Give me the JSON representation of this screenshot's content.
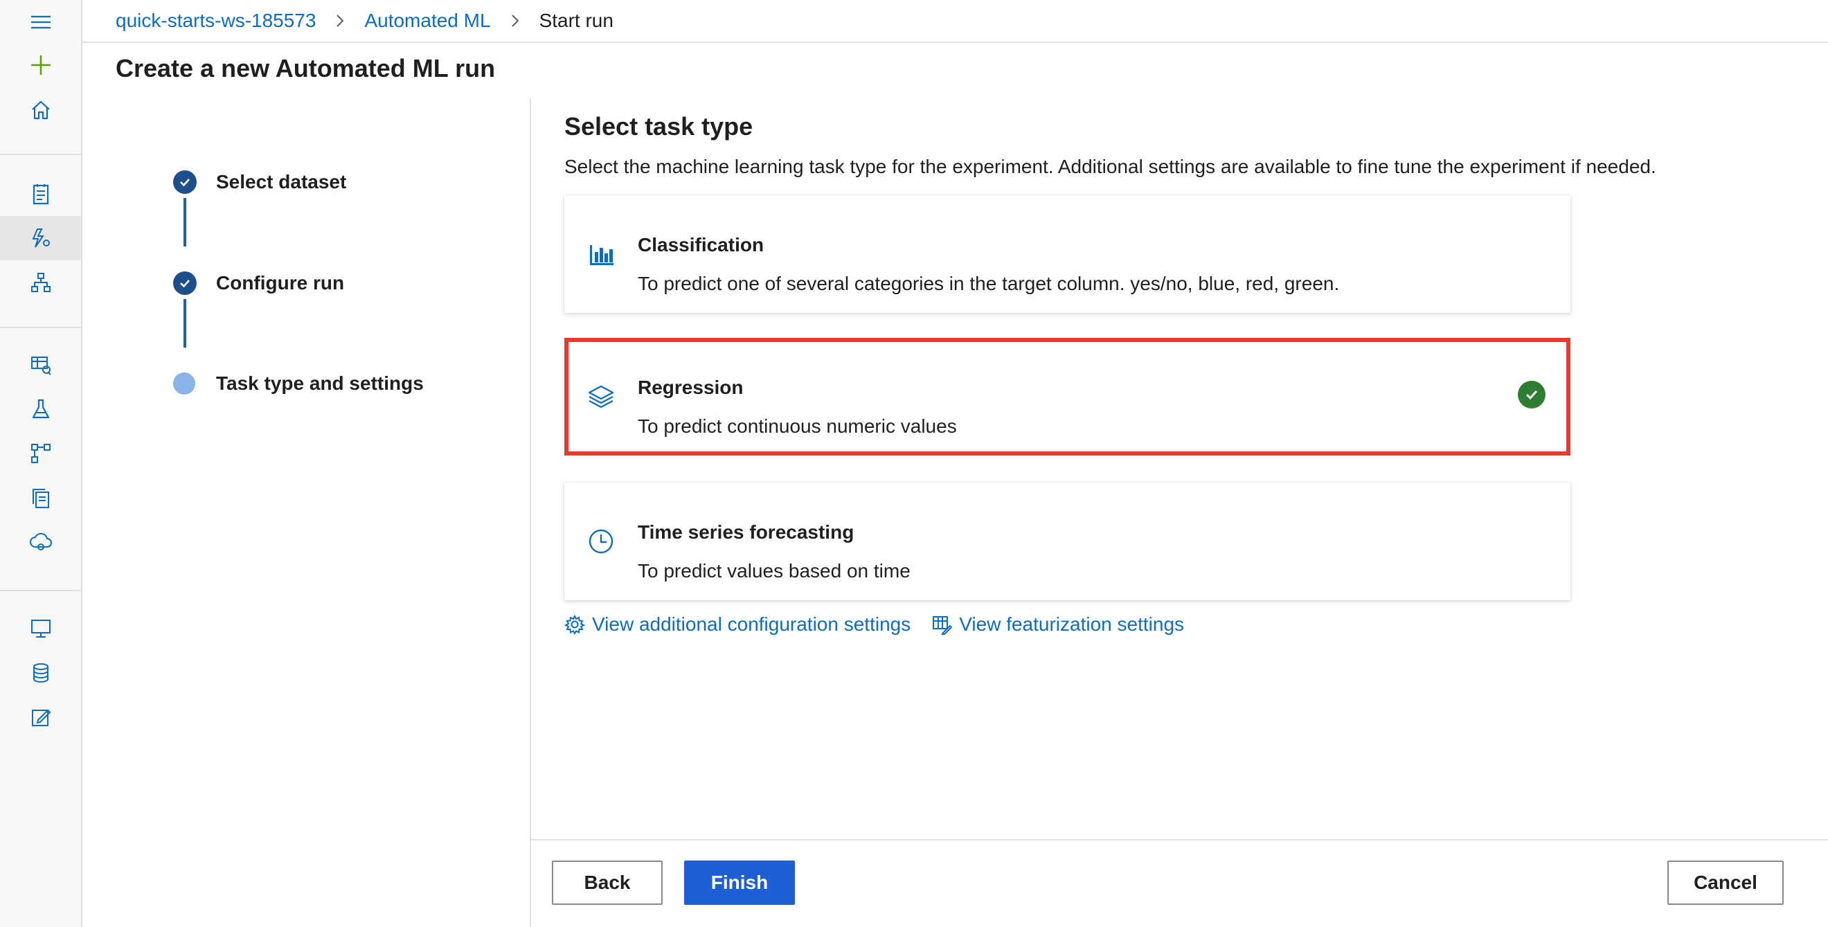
{
  "breadcrumb": {
    "workspace": "quick-starts-ws-185573",
    "section": "Automated ML",
    "current": "Start run"
  },
  "page": {
    "title": "Create a new Automated ML run"
  },
  "stepper": {
    "steps": [
      {
        "label": "Select dataset",
        "state": "completed"
      },
      {
        "label": "Configure run",
        "state": "completed"
      },
      {
        "label": "Task type and settings",
        "state": "current"
      }
    ]
  },
  "task": {
    "title": "Select task type",
    "description": "Select the machine learning task type for the experiment. Additional settings are available to fine tune the experiment if needed.",
    "options": [
      {
        "title": "Classification",
        "description": "To predict one of several categories in the target column. yes/no, blue, red, green.",
        "icon": "bar-chart-icon",
        "selected": false
      },
      {
        "title": "Regression",
        "description": "To predict continuous numeric values",
        "icon": "layers-icon",
        "selected": true
      },
      {
        "title": "Time series forecasting",
        "description": "To predict values based on time",
        "icon": "clock-icon",
        "selected": false
      }
    ]
  },
  "links": {
    "config": "View additional configuration settings",
    "featurization": "View featurization settings"
  },
  "footer": {
    "back": "Back",
    "finish": "Finish",
    "cancel": "Cancel"
  },
  "colors": {
    "accent": "#0f6cbd",
    "primary_button": "#1f5fd6",
    "selected_border": "#e53b2e",
    "check_green": "#2e7d32",
    "step_done": "#1f4e8c",
    "step_current": "#8ab4e8"
  },
  "rail_icons": [
    "hamburger-icon",
    "plus-icon",
    "home-icon",
    "notebook-icon",
    "automl-icon",
    "designer-icon",
    "datasets-icon",
    "experiments-icon",
    "pipelines-icon",
    "models-icon",
    "endpoints-icon",
    "compute-icon",
    "datastores-icon",
    "labeling-icon"
  ]
}
